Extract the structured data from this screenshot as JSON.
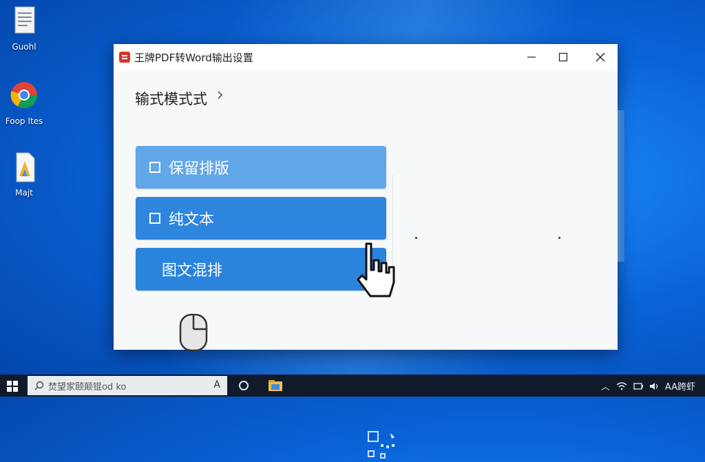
{
  "desktop": {
    "icons": [
      {
        "label": "Guohl",
        "icon": "document-icon"
      },
      {
        "label": "Foop Ites",
        "icon": "chrome-icon"
      },
      {
        "label": "Majt",
        "icon": "file-icon"
      }
    ]
  },
  "window": {
    "title": "王牌PDF转Word输出设置",
    "controls": {
      "minimize": "—",
      "maximize": "☐",
      "close": "✕"
    }
  },
  "settings": {
    "section_title": "输式模式式",
    "options": [
      {
        "label": "保留排版",
        "checked": false
      },
      {
        "label": "纯文本",
        "checked": false
      },
      {
        "label": "图文混排"
      }
    ]
  },
  "taskbar": {
    "search_placeholder": "焚望家颐颠锟od ko",
    "search_mic": "A",
    "tray_text": "AA跨虾"
  },
  "colors": {
    "option_light": "#62a7e8",
    "option_blue": "#2e86de",
    "desktop_blue": "#0a64d8",
    "taskbar": "#101a2b"
  }
}
